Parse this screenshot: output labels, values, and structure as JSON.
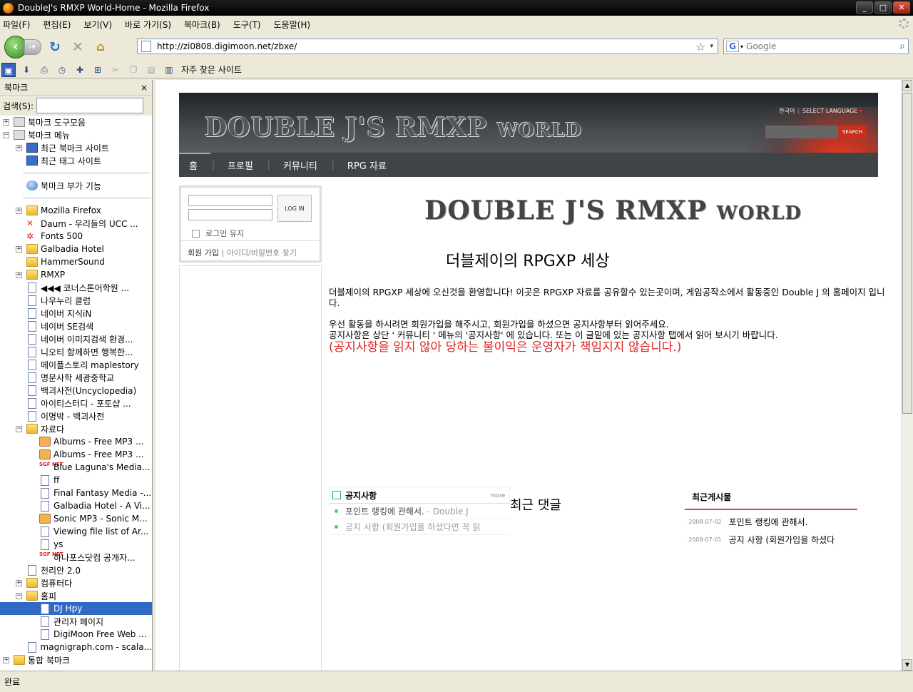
{
  "window": {
    "title": "DoubleJ's RMXP World-Home - Mozilla Firefox"
  },
  "menu": [
    "파일(F)",
    "편집(E)",
    "보기(V)",
    "바로 가기(S)",
    "북마크(B)",
    "도구(T)",
    "도움말(H)"
  ],
  "nav": {
    "url": "http://zi0808.digimoon.net/zbxe/",
    "search_placeholder": "Google"
  },
  "bookmarks_toolbar": {
    "favorites_label": "자주 찾은 사이트"
  },
  "sidebar": {
    "title": "북마크",
    "close": "×",
    "search_label": "검색(S):",
    "tree": [
      {
        "label": "북마크 도구모음",
        "icon": "toolbar-folder",
        "indent": 0,
        "twisty": "+"
      },
      {
        "label": "북마크 메뉴",
        "icon": "menu-folder",
        "indent": 0,
        "twisty": "−"
      },
      {
        "label": "최근 북마크 사이트",
        "icon": "smart-folder",
        "indent": 1,
        "twisty": "+"
      },
      {
        "label": "최근 태그 사이트",
        "icon": "smart-folder",
        "indent": 1,
        "twisty": ""
      },
      {
        "sep": true
      },
      {
        "label": "북마크 부가 기능",
        "icon": "globe",
        "indent": 1,
        "twisty": ""
      },
      {
        "sep": true
      },
      {
        "label": "Mozilla Firefox",
        "icon": "folder",
        "indent": 1,
        "twisty": "+"
      },
      {
        "label": "Daum - 우리들의 UCC ...",
        "icon": "daum",
        "indent": 1,
        "twisty": ""
      },
      {
        "label": "Fonts 500",
        "icon": "fonts",
        "indent": 1,
        "twisty": ""
      },
      {
        "label": "Galbadia Hotel",
        "icon": "folder",
        "indent": 1,
        "twisty": "+"
      },
      {
        "label": "HammerSound",
        "icon": "folder",
        "indent": 1,
        "twisty": ""
      },
      {
        "label": "RMXP",
        "icon": "folder",
        "indent": 1,
        "twisty": "+"
      },
      {
        "label": "◀◀◀ 코너스톤어학원 ...",
        "icon": "page",
        "indent": 1,
        "twisty": ""
      },
      {
        "label": "나우누리 클럽",
        "icon": "page",
        "indent": 1,
        "twisty": ""
      },
      {
        "label": "네이버 지식iN",
        "icon": "page",
        "indent": 1,
        "twisty": ""
      },
      {
        "label": "네이버 SE검색",
        "icon": "page",
        "indent": 1,
        "twisty": ""
      },
      {
        "label": "네이버 이미지검색 환경...",
        "icon": "page",
        "indent": 1,
        "twisty": ""
      },
      {
        "label": "니오티 함께하면 행복한...",
        "icon": "page",
        "indent": 1,
        "twisty": ""
      },
      {
        "label": "메이플스토리 maplestory",
        "icon": "page",
        "indent": 1,
        "twisty": ""
      },
      {
        "label": "명문사학 세광중학교",
        "icon": "page",
        "indent": 1,
        "twisty": ""
      },
      {
        "label": "백괴사전(Uncyclopedia)",
        "icon": "page",
        "indent": 1,
        "twisty": ""
      },
      {
        "label": "아이티스터디 - 포토샵 ...",
        "icon": "page",
        "indent": 1,
        "twisty": ""
      },
      {
        "label": "이명박 - 백괴사전",
        "icon": "page",
        "indent": 1,
        "twisty": ""
      },
      {
        "label": "자료다",
        "icon": "folder",
        "indent": 1,
        "twisty": "−"
      },
      {
        "label": "Albums - Free MP3 ...",
        "icon": "face",
        "indent": 2,
        "twisty": ""
      },
      {
        "label": "Albums - Free MP3 ...",
        "icon": "face",
        "indent": 2,
        "twisty": ""
      },
      {
        "label": "Blue Laguna's Media...",
        "icon": "sgf",
        "indent": 2,
        "twisty": ""
      },
      {
        "label": "ff",
        "icon": "page",
        "indent": 2,
        "twisty": ""
      },
      {
        "label": "Final Fantasy Media -...",
        "icon": "page",
        "indent": 2,
        "twisty": ""
      },
      {
        "label": "Galbadia Hotel - A Vi...",
        "icon": "page",
        "indent": 2,
        "twisty": ""
      },
      {
        "label": "Sonic MP3 - Sonic M...",
        "icon": "face",
        "indent": 2,
        "twisty": ""
      },
      {
        "label": "Viewing file list of Ar...",
        "icon": "page",
        "indent": 2,
        "twisty": ""
      },
      {
        "label": "ys",
        "icon": "page",
        "indent": 2,
        "twisty": ""
      },
      {
        "label": "하나포스닷컴 공개자...",
        "icon": "sgf",
        "indent": 2,
        "twisty": ""
      },
      {
        "label": "천리안 2.0",
        "icon": "page",
        "indent": 1,
        "twisty": ""
      },
      {
        "label": "컴퓨터다",
        "icon": "folder",
        "indent": 1,
        "twisty": "+"
      },
      {
        "label": "홈피",
        "icon": "folder",
        "indent": 1,
        "twisty": "−"
      },
      {
        "label": "DJ Hpy",
        "icon": "page",
        "indent": 2,
        "twisty": "",
        "selected": true
      },
      {
        "label": "관리자 페이지",
        "icon": "page",
        "indent": 2,
        "twisty": ""
      },
      {
        "label": "DigiMoon Free Web ...",
        "icon": "page",
        "indent": 2,
        "twisty": ""
      },
      {
        "label": "magnigraph.com - scala...",
        "icon": "page",
        "indent": 1,
        "twisty": ""
      },
      {
        "label": "통합 북마크",
        "icon": "unified",
        "indent": 0,
        "twisty": "+"
      }
    ]
  },
  "status": "완료",
  "site": {
    "lang_current": "한국어",
    "lang_select": "SELECT LANGUAGE",
    "search_btn": "SEARCH",
    "logo_big1": "DOUBLE J",
    "logo_big2": "'S RMXP",
    "logo_small": "WORLD",
    "gnb": [
      "홈",
      "프로필",
      "커뮤니티",
      "RPG 자료"
    ],
    "login": {
      "button": "LOG IN",
      "remember": "로그인 유지",
      "signup": "회원 가입",
      "find": "아이디/비밀번호 찾기"
    },
    "main_title": "더블제이의 RPGXP 세상",
    "intro_p1": "더블제이의 RPGXP 세상에 오신것을 환영합니다! 이곳은 RPGXP 자료를 공유할수 있는곳이며, 게임공작소에서 활동중인 Double J 의 홈페이지 입니다.",
    "intro_p2a": "우선 활동을 하시려면 회원가입을 해주시고, 회원가입을 하셨으면 공지사항부터 읽어주세요.",
    "intro_p2b": "공지사항은 상단 ' 커뮤니티 ' 메뉴의 '공지사항' 에 있습니다. 또는 이 글밑에 있는 공지사항 탭에서 읽어 보시기 바랍니다.",
    "intro_red": "(공지사항을 읽지 않아 당하는 불이익은 운영자가 책임지지 않습니다.)",
    "notice": {
      "title": "공지사항",
      "more": "more",
      "items": [
        {
          "text": "포인트 랭킹에 관해서.",
          "author": "- Double J"
        },
        {
          "text": "공지 사항 (회원가입을 하셨다면 꼭 읽",
          "author": ""
        }
      ]
    },
    "comments_title": "최근 댓글",
    "recent": {
      "title": "최근게시물",
      "items": [
        {
          "date": "2008-07-02",
          "text": "포인트 랭킹에 관해서."
        },
        {
          "date": "2008-07-01",
          "text": "공지 사항 (회원가입을 하셨다"
        }
      ]
    }
  }
}
